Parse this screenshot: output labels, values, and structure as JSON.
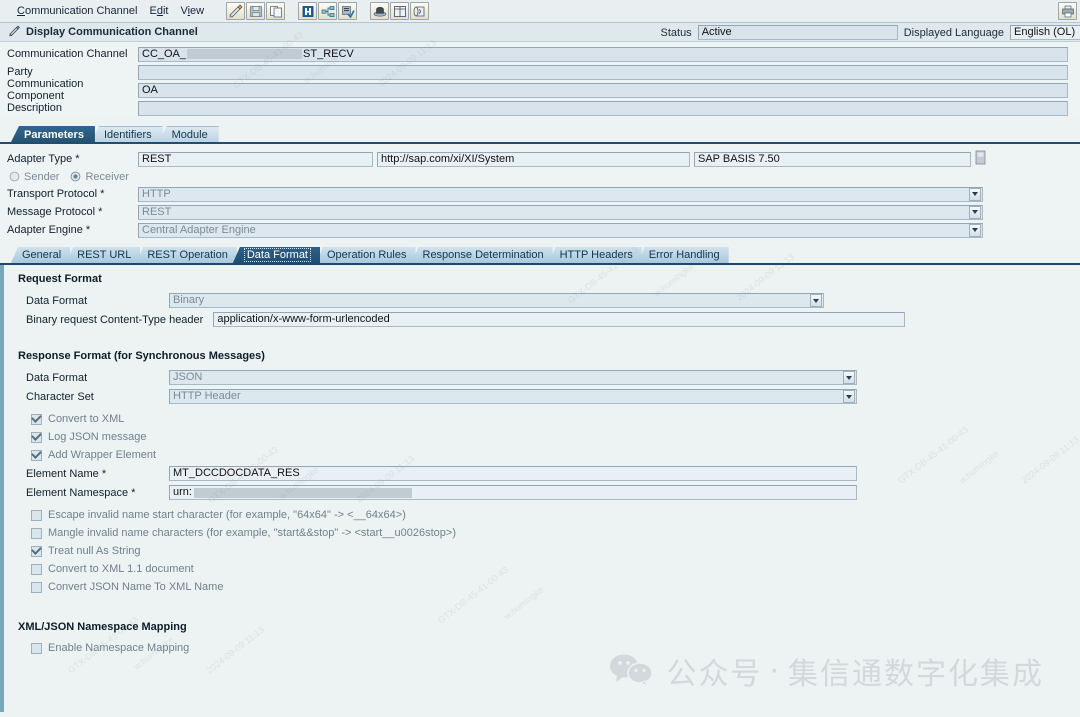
{
  "menu": {
    "items": [
      {
        "label": "Communication Channel",
        "accel_index": 0
      },
      {
        "label": "Edit",
        "accel_index": 1
      },
      {
        "label": "View",
        "accel_index": 1
      }
    ],
    "toolbar_groups": [
      [
        "edit-pencil-icon",
        "save-disk-icon",
        "copy-pages-icon"
      ],
      [
        "display-object-icon",
        "where-used-icon",
        "check-object-icon"
      ],
      [
        "activate-icon",
        "grid-layout-icon",
        "history-icon"
      ]
    ],
    "right_button": "print-icon"
  },
  "header": {
    "icon": "pen-object-icon",
    "title": "Display Communication Channel",
    "status_label": "Status",
    "status_value": "Active",
    "language_label": "Displayed Language",
    "language_value": "English (OL)"
  },
  "form": {
    "fields": [
      {
        "label": "Communication Channel",
        "value_prefix": "CC_OA_",
        "value_suffix": "ST_RECV",
        "redacted": true
      },
      {
        "label": "Party",
        "value": "",
        "redacted": false
      },
      {
        "label": "Communication Component",
        "value": "OA",
        "redacted": false
      },
      {
        "label": "Description",
        "value": "",
        "redacted": false
      }
    ]
  },
  "outer_tabs": [
    {
      "label": "Parameters",
      "active": true
    },
    {
      "label": "Identifiers",
      "active": false
    },
    {
      "label": "Module",
      "active": false
    }
  ],
  "adapter": {
    "type_label": "Adapter Type",
    "type_value": "REST",
    "namespace_value": "http://sap.com/xi/XI/System",
    "swcv_value": "SAP BASIS 7.50",
    "browse_icon": "value-help-icon",
    "direction": {
      "sender_label": "Sender",
      "receiver_label": "Receiver",
      "selected": "Receiver"
    },
    "rows": [
      {
        "label": "Transport Protocol",
        "value": "HTTP"
      },
      {
        "label": "Message Protocol",
        "value": "REST"
      },
      {
        "label": "Adapter Engine",
        "value": "Central Adapter Engine"
      }
    ]
  },
  "inner_tabs": [
    {
      "label": "General",
      "active": false
    },
    {
      "label": "REST URL",
      "active": false
    },
    {
      "label": "REST Operation",
      "active": false
    },
    {
      "label": "Data Format",
      "active": true
    },
    {
      "label": "Operation Rules",
      "active": false
    },
    {
      "label": "Response Determination",
      "active": false
    },
    {
      "label": "HTTP Headers",
      "active": false
    },
    {
      "label": "Error Handling",
      "active": false
    }
  ],
  "request_format": {
    "title": "Request Format",
    "data_format_label": "Data Format",
    "data_format_value": "Binary",
    "content_type_label": "Binary request Content-Type header",
    "content_type_value": "application/x-www-form-urlencoded"
  },
  "response_format": {
    "title": "Response Format (for Synchronous Messages)",
    "data_format_label": "Data Format",
    "data_format_value": "JSON",
    "charset_label": "Character Set",
    "charset_value": "HTTP Header",
    "checkboxes_top": [
      {
        "label": "Convert to XML",
        "checked": true
      },
      {
        "label": "Log JSON message",
        "checked": true
      },
      {
        "label": "Add Wrapper Element",
        "checked": true
      }
    ],
    "element_name_label": "Element Name",
    "element_name_value": "MT_DCCDOCDATA_RES",
    "element_ns_label": "Element Namespace",
    "element_ns_value": "urn:",
    "element_ns_redacted": true,
    "checkboxes_bottom": [
      {
        "label": "Escape invalid name start character (for example, \"64x64\" -> <__64x64>)",
        "checked": false
      },
      {
        "label": "Mangle invalid name characters (for example, \"start&&stop\" -> <start__u0026stop>)",
        "checked": false
      },
      {
        "label": "Treat null As String",
        "checked": true
      },
      {
        "label": "Convert to XML 1.1 document",
        "checked": false
      },
      {
        "label": "Convert JSON Name To XML Name",
        "checked": false
      }
    ]
  },
  "namespace_mapping": {
    "title": "XML/JSON Namespace Mapping",
    "checkbox": {
      "label": "Enable Namespace Mapping",
      "checked": false
    }
  },
  "watermark": {
    "text_lines": [
      "GTX-DB-45-41-00-43",
      "w.humingke",
      "2024-09-09 11:13"
    ],
    "brand_prefix": "公众号",
    "brand_sep": "·",
    "brand_name": "集信通数字化集成",
    "brand_icon": "wechat-icon"
  },
  "colors": {
    "accent": "#1f4e72",
    "tab_active": "#2f6590",
    "field_bg": "#dde7ee",
    "panel_bg": "#edf3f3"
  }
}
